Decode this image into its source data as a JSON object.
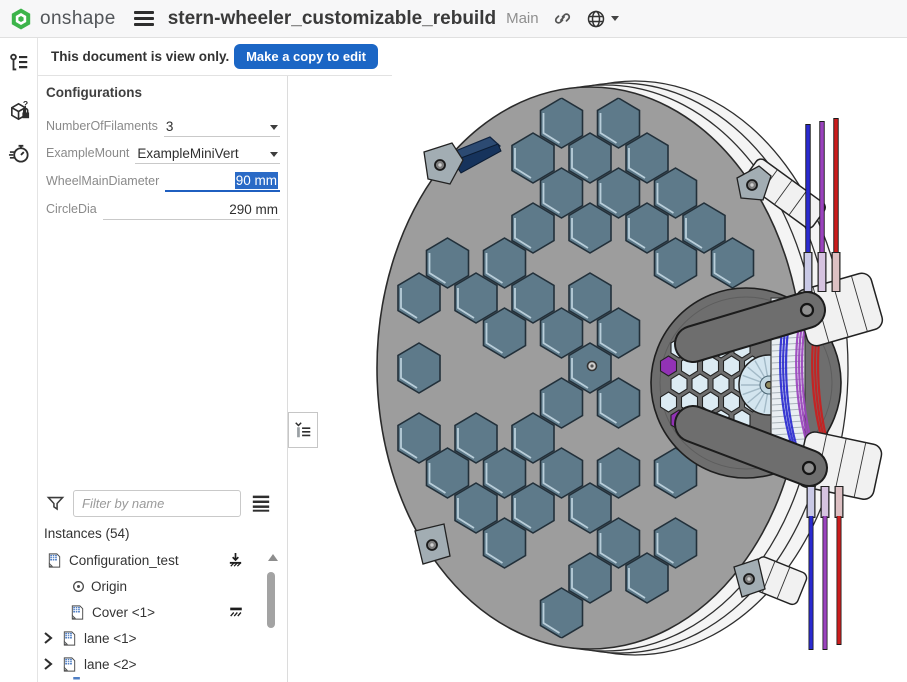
{
  "topbar": {
    "brand": "onshape",
    "title": "stern-wheeler_customizable_rebuild",
    "workspace": "Main"
  },
  "viewbar": {
    "message": "This document is view only.",
    "cta": "Make a copy to edit"
  },
  "configurations": {
    "header": "Configurations",
    "rows": [
      {
        "label": "NumberOfFilaments",
        "value": "3",
        "type": "dropdown"
      },
      {
        "label": "ExampleMount",
        "value": "ExampleMiniVert",
        "type": "dropdown"
      },
      {
        "label": "WheelMainDiameter",
        "value": "90 mm",
        "type": "text-selected"
      },
      {
        "label": "CircleDia",
        "value": "290 mm",
        "type": "text"
      }
    ]
  },
  "filter": {
    "placeholder": "Filter by name"
  },
  "instances": {
    "header": "Instances (54)",
    "items": [
      {
        "label": "Configuration_test",
        "right_icon": "insert-ground-icon"
      },
      {
        "label": "Origin",
        "right_icon": ""
      },
      {
        "label": "Cover <1>",
        "right_icon": "fixed-icon"
      },
      {
        "label": "lane <1>",
        "right_icon": ""
      },
      {
        "label": "lane <2>",
        "right_icon": ""
      }
    ]
  },
  "viewport": {
    "background": "#ffffff",
    "model": {
      "disc_color": "#9d9d9d",
      "hex_color": "#5e7a8a",
      "hex_edge": "#22303a",
      "hex_bevel": "#c9dde8",
      "rim_color": "#f4f4f4",
      "hub_color": "#6e6e6e",
      "hub_hex_color": "#dcebf3",
      "accent_purple": "#9232b5",
      "spool_color": "#d3e5ef",
      "bracket_color": "#f1f1f1",
      "tab_color": "#a2adb3",
      "clip_color": "#2c4a72",
      "outline": "#222222"
    },
    "filaments": [
      {
        "name": "filament-blue",
        "color": "#2a2ad0",
        "sleeve": "#c9c9e6"
      },
      {
        "name": "filament-purple",
        "color": "#9a43bd",
        "sleeve": "#d6c3e0"
      },
      {
        "name": "filament-red",
        "color": "#cb1d1d",
        "sleeve": "#ddc0c3"
      }
    ]
  }
}
